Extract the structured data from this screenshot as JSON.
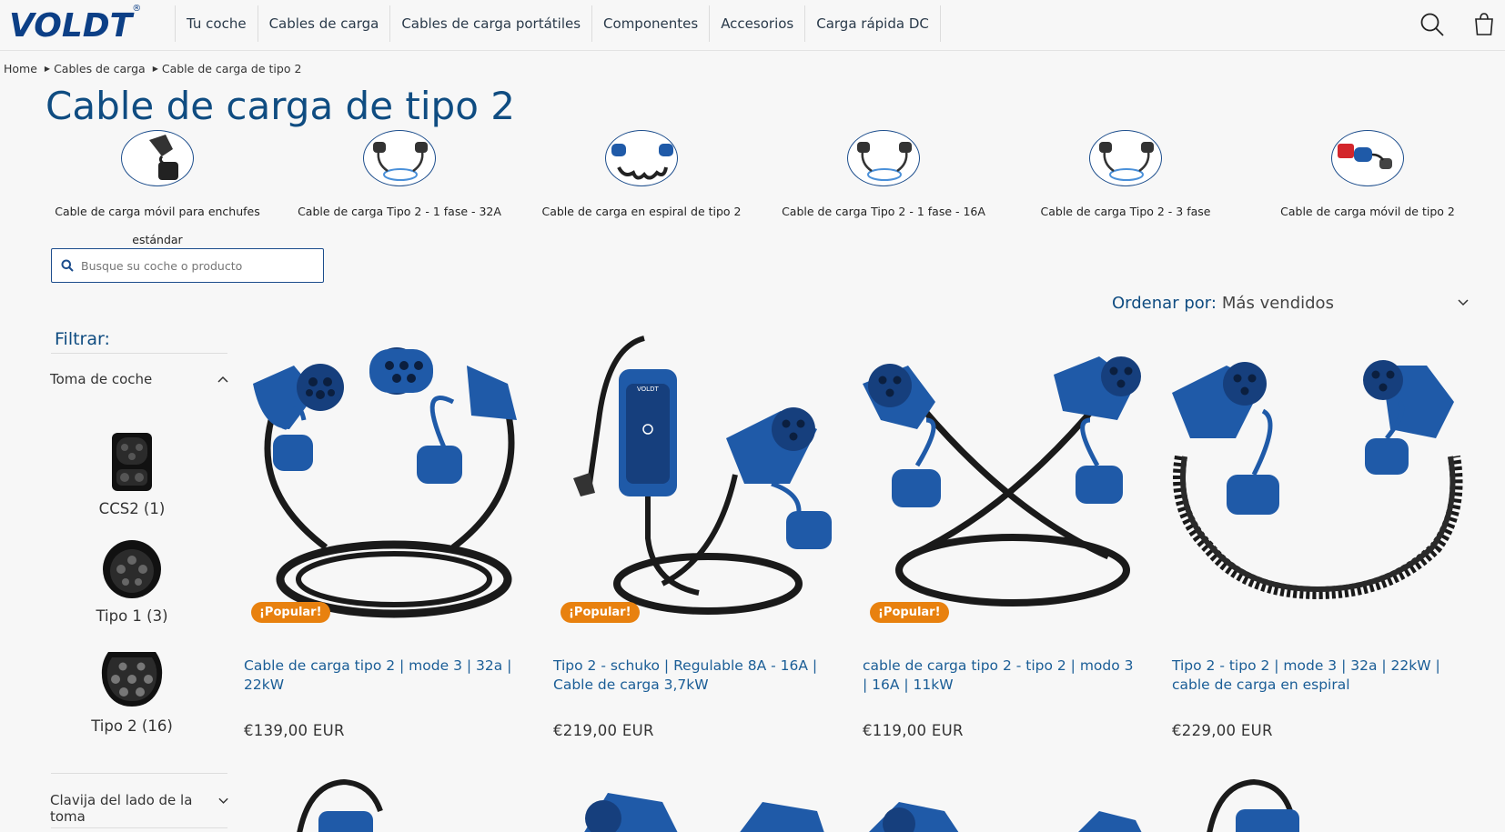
{
  "header": {
    "logo": "VOLDT",
    "logo_mark": "®",
    "nav": [
      "Tu coche",
      "Cables de carga",
      "Cables de carga portátiles",
      "Componentes",
      "Accesorios",
      "Carga rápida DC"
    ],
    "icons": [
      "search-icon",
      "cart-icon"
    ]
  },
  "breadcrumb": [
    "Home",
    "Cables de carga",
    "Cable de carga de tipo 2"
  ],
  "page_title": "Cable de carga de tipo 2",
  "categories": [
    {
      "label": "Cable de carga móvil para enchufes estándar",
      "icon": "schuko-plug-thumbnail"
    },
    {
      "label": "Cable de carga Tipo 2 - 1 fase - 32A",
      "icon": "type2-cable-thumbnail"
    },
    {
      "label": "Cable de carga en espiral de tipo 2",
      "icon": "spiral-cable-thumbnail"
    },
    {
      "label": "Cable de carga Tipo 2 - 1 fase - 16A",
      "icon": "type2-cable-thumbnail"
    },
    {
      "label": "Cable de carga Tipo 2 - 3 fase",
      "icon": "type2-cable-thumbnail"
    },
    {
      "label": "Cable de carga móvil de tipo 2",
      "icon": "cee-plug-thumbnail"
    }
  ],
  "search": {
    "placeholder": "Busque su coche o producto"
  },
  "sort": {
    "label": "Ordenar por:",
    "value": "Más vendidos"
  },
  "filter": {
    "title": "Filtrar:",
    "facet1": {
      "label": "Toma de coche",
      "options": [
        {
          "label": "CCS2 (1)",
          "icon": "ccs2-socket-icon"
        },
        {
          "label": "Tipo 1 (3)",
          "icon": "type1-socket-icon"
        },
        {
          "label": "Tipo 2 (16)",
          "icon": "type2-socket-icon"
        }
      ]
    },
    "facet2": {
      "label": "Clavija del lado de la toma"
    }
  },
  "products": [
    {
      "badge": "¡Popular!",
      "title": "Cable de carga tipo 2 | mode 3 | 32a | 22kW",
      "price": "€139,00 EUR"
    },
    {
      "badge": "¡Popular!",
      "title": "Tipo 2 - schuko | Regulable 8A - 16A | Cable de carga 3,7kW",
      "price": "€219,00 EUR"
    },
    {
      "badge": "¡Popular!",
      "title": "cable de carga tipo 2 - tipo 2 | modo 3 | 16A | 11kW",
      "price": "€119,00 EUR"
    },
    {
      "badge": "",
      "title": "Tipo 2 - tipo 2 | mode 3 | 32a | 22kW | cable de carga en espiral",
      "price": "€229,00 EUR"
    }
  ],
  "colors": {
    "brand": "#0c3f86",
    "link": "#1a5d96",
    "badge": "#e8810f",
    "product_blue": "#1f5aa8"
  }
}
